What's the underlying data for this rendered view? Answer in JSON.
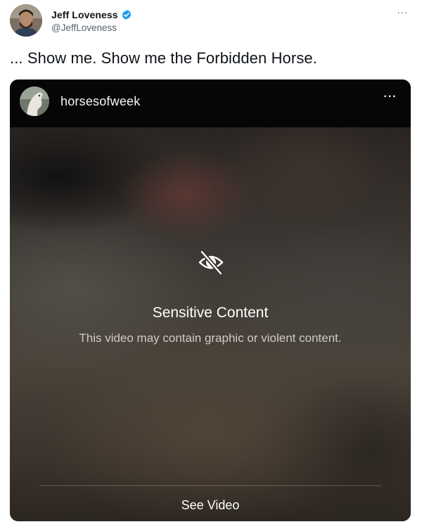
{
  "tweet": {
    "author_name": "Jeff Loveness",
    "author_handle": "@JeffLoveness",
    "more_icon": "ellipsis-icon",
    "text": "... Show me. Show me the Forbidden Horse."
  },
  "embed": {
    "username": "horsesofweek",
    "more_icon": "ellipsis-icon",
    "warning_icon": "eye-slash-icon",
    "warning_title": "Sensitive Content",
    "warning_description": "This video may contain graphic or violent content.",
    "action_label": "See Video"
  },
  "colors": {
    "verified": "#1d9bf0",
    "text_primary": "#0f1419",
    "text_secondary": "#536471"
  }
}
